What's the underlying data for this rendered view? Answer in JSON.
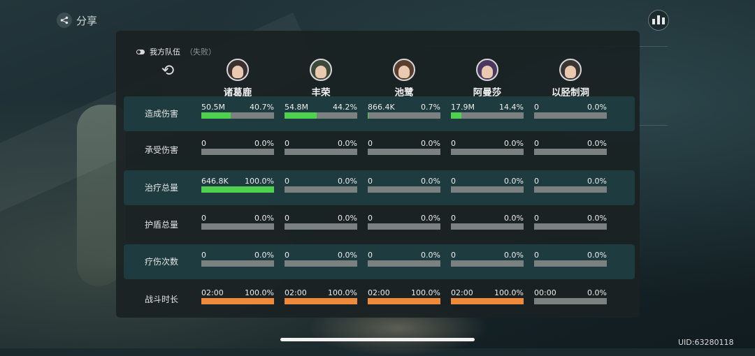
{
  "header": {
    "share_label": "分享"
  },
  "panel": {
    "team_label": "我方队伍",
    "result_label": "（失败）"
  },
  "heroes": [
    {
      "name": "诸葛鹿",
      "avatar_color": "#3a3030"
    },
    {
      "name": "丰荣",
      "avatar_color": "#3b4a38"
    },
    {
      "name": "池鹭",
      "avatar_color": "#5a3d2e"
    },
    {
      "name": "阿曼莎",
      "avatar_color": "#4a3860"
    },
    {
      "name": "以胫制洞",
      "avatar_color": "#3a3434"
    }
  ],
  "rows": [
    {
      "label": "造成伤害",
      "color": "green",
      "cells": [
        {
          "value": "50.5M",
          "pct": "40.7%",
          "fraction": 0.407
        },
        {
          "value": "54.8M",
          "pct": "44.2%",
          "fraction": 0.442
        },
        {
          "value": "866.4K",
          "pct": "0.7%",
          "fraction": 0.007
        },
        {
          "value": "17.9M",
          "pct": "14.4%",
          "fraction": 0.144
        },
        {
          "value": "0",
          "pct": "0.0%",
          "fraction": 0
        }
      ]
    },
    {
      "label": "承受伤害",
      "color": "green",
      "cells": [
        {
          "value": "0",
          "pct": "0.0%",
          "fraction": 0
        },
        {
          "value": "0",
          "pct": "0.0%",
          "fraction": 0
        },
        {
          "value": "0",
          "pct": "0.0%",
          "fraction": 0
        },
        {
          "value": "0",
          "pct": "0.0%",
          "fraction": 0
        },
        {
          "value": "0",
          "pct": "0.0%",
          "fraction": 0
        }
      ]
    },
    {
      "label": "治疗总量",
      "color": "green",
      "cells": [
        {
          "value": "646.8K",
          "pct": "100.0%",
          "fraction": 1.0
        },
        {
          "value": "0",
          "pct": "0.0%",
          "fraction": 0
        },
        {
          "value": "0",
          "pct": "0.0%",
          "fraction": 0
        },
        {
          "value": "0",
          "pct": "0.0%",
          "fraction": 0
        },
        {
          "value": "0",
          "pct": "0.0%",
          "fraction": 0
        }
      ]
    },
    {
      "label": "护盾总量",
      "color": "green",
      "cells": [
        {
          "value": "0",
          "pct": "0.0%",
          "fraction": 0
        },
        {
          "value": "0",
          "pct": "0.0%",
          "fraction": 0
        },
        {
          "value": "0",
          "pct": "0.0%",
          "fraction": 0
        },
        {
          "value": "0",
          "pct": "0.0%",
          "fraction": 0
        },
        {
          "value": "0",
          "pct": "0.0%",
          "fraction": 0
        }
      ]
    },
    {
      "label": "疗伤次数",
      "color": "green",
      "cells": [
        {
          "value": "0",
          "pct": "0.0%",
          "fraction": 0
        },
        {
          "value": "0",
          "pct": "0.0%",
          "fraction": 0
        },
        {
          "value": "0",
          "pct": "0.0%",
          "fraction": 0
        },
        {
          "value": "0",
          "pct": "0.0%",
          "fraction": 0
        },
        {
          "value": "0",
          "pct": "0.0%",
          "fraction": 0
        }
      ]
    },
    {
      "label": "战斗时长",
      "color": "orange",
      "cells": [
        {
          "value": "02:00",
          "pct": "100.0%",
          "fraction": 1.0
        },
        {
          "value": "02:00",
          "pct": "100.0%",
          "fraction": 1.0
        },
        {
          "value": "02:00",
          "pct": "100.0%",
          "fraction": 1.0
        },
        {
          "value": "02:00",
          "pct": "100.0%",
          "fraction": 1.0
        },
        {
          "value": "00:00",
          "pct": "0.0%",
          "fraction": 0
        }
      ]
    }
  ],
  "footer": {
    "uid": "UID:63280118"
  },
  "colors": {
    "green_bar": "#4fd04f",
    "orange_bar": "#ef8a3a",
    "track": "#7b8080",
    "alt_row": "#1e3b3f"
  },
  "icons": {
    "share": "share-icon",
    "stats": "bar-chart-icon",
    "refresh": "refresh-icon"
  }
}
